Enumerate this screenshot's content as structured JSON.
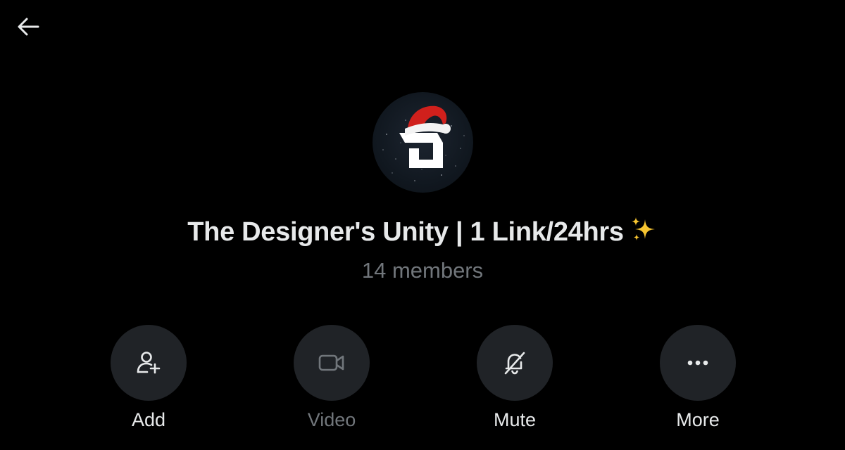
{
  "group": {
    "name": "The Designer's Unity | 1 Link/24hrs",
    "name_emoji": "sparkles",
    "member_count": "14 members"
  },
  "actions": [
    {
      "label": "Add",
      "icon": "add-person-icon",
      "enabled": true
    },
    {
      "label": "Video",
      "icon": "video-camera-icon",
      "enabled": false
    },
    {
      "label": "Mute",
      "icon": "bell-off-icon",
      "enabled": true
    },
    {
      "label": "More",
      "icon": "more-dots-icon",
      "enabled": true
    }
  ],
  "colors": {
    "background": "#000000",
    "primary_text": "#e7e9ea",
    "secondary_text": "#71767b",
    "button_fill": "#202327"
  }
}
